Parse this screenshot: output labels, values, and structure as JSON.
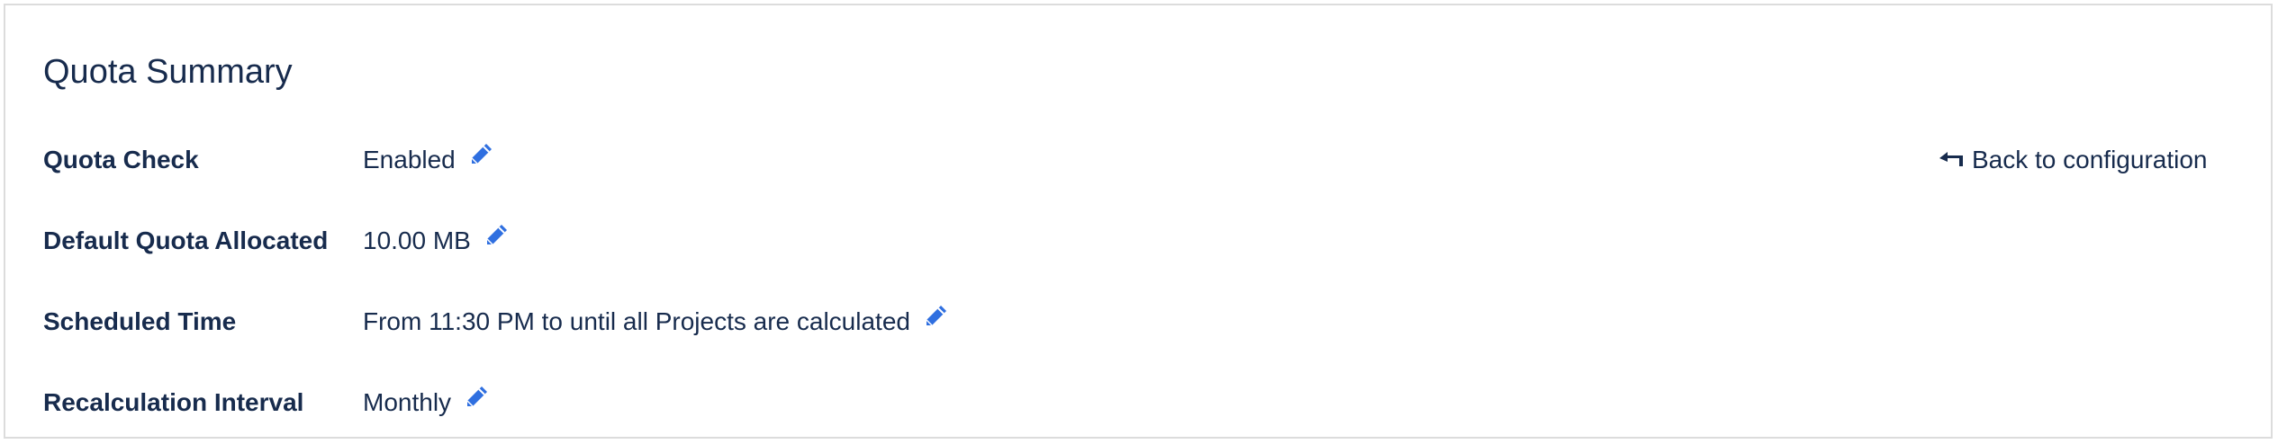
{
  "panel": {
    "title": "Quota Summary",
    "back_link_label": "Back to configuration"
  },
  "rows": [
    {
      "label": "Quota Check",
      "value": "Enabled",
      "edit_icon": "pencil-icon"
    },
    {
      "label": "Default Quota Allocated",
      "value": "10.00 MB",
      "edit_icon": "pencil-icon"
    },
    {
      "label": "Scheduled Time",
      "value": "From 11:30 PM to until all Projects are calculated",
      "edit_icon": "pencil-icon"
    },
    {
      "label": "Recalculation Interval",
      "value": "Monthly",
      "edit_icon": "pencil-icon"
    }
  ],
  "icons": {
    "edit": "pencil-icon",
    "back": "arrow-back-icon"
  },
  "colors": {
    "text": "#172b4d",
    "accent": "#2f6fe0",
    "border": "#dcdcdc"
  }
}
